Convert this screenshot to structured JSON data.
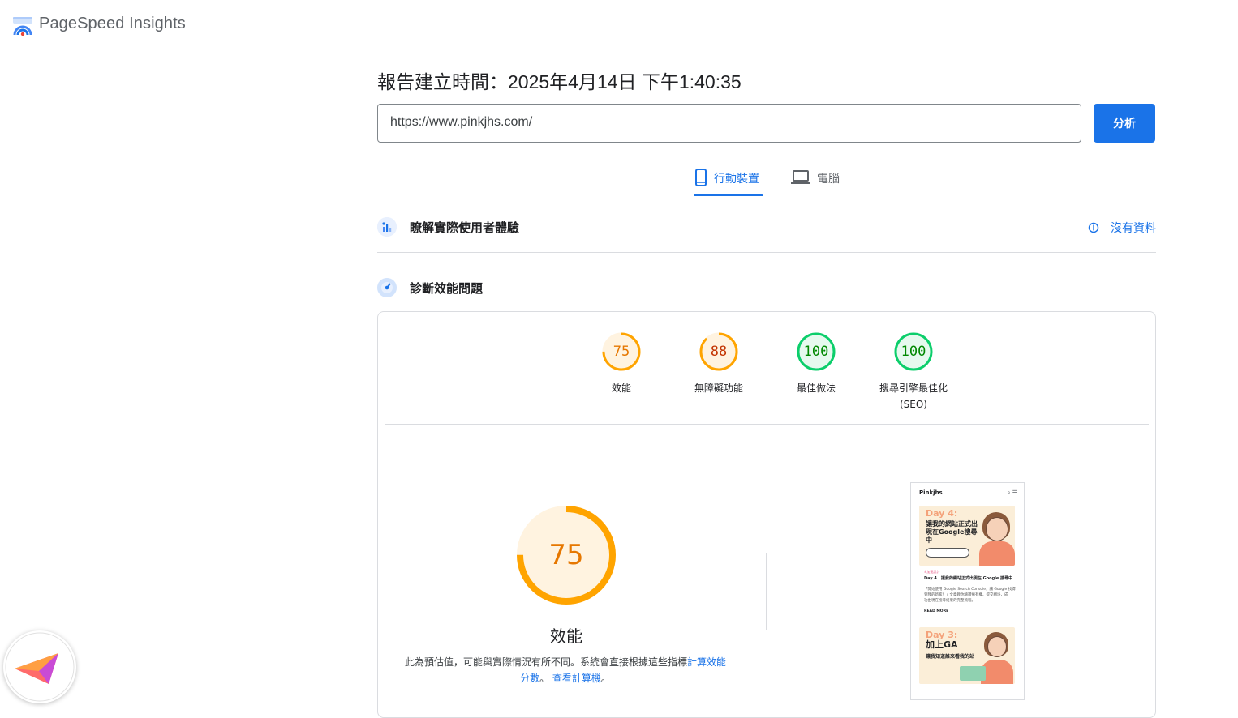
{
  "app": {
    "title": "PageSpeed Insights"
  },
  "report": {
    "time_label": "報告建立時間：2025年4月14日 下午1:40:35"
  },
  "search": {
    "url_value": "https://www.pinkjhs.com/",
    "analyze_label": "分析"
  },
  "tabs": [
    {
      "label": "行動裝置",
      "icon": "smartphone-icon",
      "active": true
    },
    {
      "label": "電腦",
      "icon": "laptop-icon",
      "active": false
    }
  ],
  "field_data": {
    "title": "瞭解實際使用者體驗",
    "no_data_label": "沒有資料",
    "icon": "users-chart-icon"
  },
  "diagnostics": {
    "title": "診斷效能問題",
    "icon": "gauge-icon"
  },
  "scores": [
    {
      "value": "75",
      "label": "效能",
      "label2": "",
      "color": "#e67700",
      "ring": "#ffa400",
      "bg": "#fff3e0",
      "fraction": 0.75
    },
    {
      "value": "88",
      "label": "無障礙功能",
      "label2": "",
      "color": "#c33300",
      "ring": "#ffa400",
      "bg": "#fff3e0",
      "fraction": 0.88
    },
    {
      "value": "100",
      "label": "最佳做法",
      "label2": "",
      "color": "#008800",
      "ring": "#0cce6b",
      "bg": "#e6f9ee",
      "fraction": 1.0
    },
    {
      "value": "100",
      "label": "搜尋引擎最佳化",
      "label2": "(SEO)",
      "color": "#008800",
      "ring": "#0cce6b",
      "bg": "#e6f9ee",
      "fraction": 1.0
    }
  ],
  "performance": {
    "score": "75",
    "fraction": 0.75,
    "label": "效能",
    "desc_prefix": "此為預估值，可能與實際情況有所不同。系統會直接根據這些指標",
    "desc_link": "計算效能分數",
    "desc_sep": "。",
    "calc_link": "查看計算機",
    "desc_end": "。"
  },
  "preview": {
    "site_name": "Pinkjhs",
    "card1_day": "Day 4:",
    "card1_title": "讓我的網站正式出現在Google搜尋中",
    "post_tag": "#加速設計",
    "post_title": "Day 4｜讓我的網站正式出現在 Google 搜尋中",
    "post_line1": "「開始使用 Google Search Console，讓 Google 找得",
    "post_line2": "到我的新家！」文章教你驗證擁有權、提交網址，成",
    "post_line3": "功出現在搜尋結果的完整流程。",
    "read_more": "READ MORE",
    "card2_day": "Day 3:",
    "card2_title": "加上GA",
    "card2_sub": "讓我知道誰來看我的站"
  }
}
